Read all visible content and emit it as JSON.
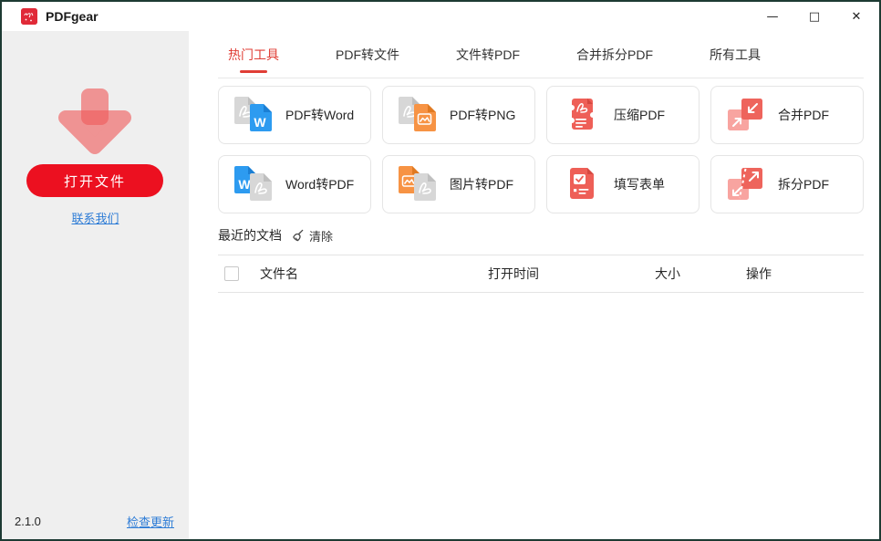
{
  "window": {
    "title": "PDFgear",
    "controls": {
      "minimize": "—",
      "maximize": "□",
      "close": "✕"
    }
  },
  "sidebar": {
    "download_icon": "download-arrow-icon",
    "open_button": "打开文件",
    "contact_link": "联系我们",
    "version": "2.1.0",
    "update_link": "检查更新"
  },
  "tabs": {
    "items": [
      {
        "label": "热门工具",
        "active": true
      },
      {
        "label": "PDF转文件",
        "active": false
      },
      {
        "label": "文件转PDF",
        "active": false
      },
      {
        "label": "合并拆分PDF",
        "active": false
      },
      {
        "label": "所有工具",
        "active": false
      }
    ]
  },
  "tools": {
    "cards": [
      {
        "label": "PDF转Word",
        "icon": "pdf-to-word-icon"
      },
      {
        "label": "PDF转PNG",
        "icon": "pdf-to-png-icon"
      },
      {
        "label": "压缩PDF",
        "icon": "compress-pdf-icon"
      },
      {
        "label": "合并PDF",
        "icon": "merge-pdf-icon"
      },
      {
        "label": "Word转PDF",
        "icon": "word-to-pdf-icon"
      },
      {
        "label": "图片转PDF",
        "icon": "image-to-pdf-icon"
      },
      {
        "label": "填写表单",
        "icon": "fill-form-icon"
      },
      {
        "label": "拆分PDF",
        "icon": "split-pdf-icon"
      }
    ]
  },
  "recent": {
    "title": "最近的文档",
    "clear_icon": "broom-icon",
    "clear_label": "清除",
    "table": {
      "columns": [
        "文件名",
        "打开时间",
        "大小",
        "操作"
      ],
      "rows": []
    }
  },
  "colors": {
    "brand_red": "#ec1020",
    "tab_active_red": "#e03e36",
    "link_blue": "#2e7cd6",
    "icon_salmon": "#ee645c",
    "icon_pink": "#f8a4a0",
    "icon_blue": "#2d9bf0",
    "icon_orange": "#f79344",
    "icon_gray": "#d7d7d7",
    "window_border": "#1d3a33"
  }
}
